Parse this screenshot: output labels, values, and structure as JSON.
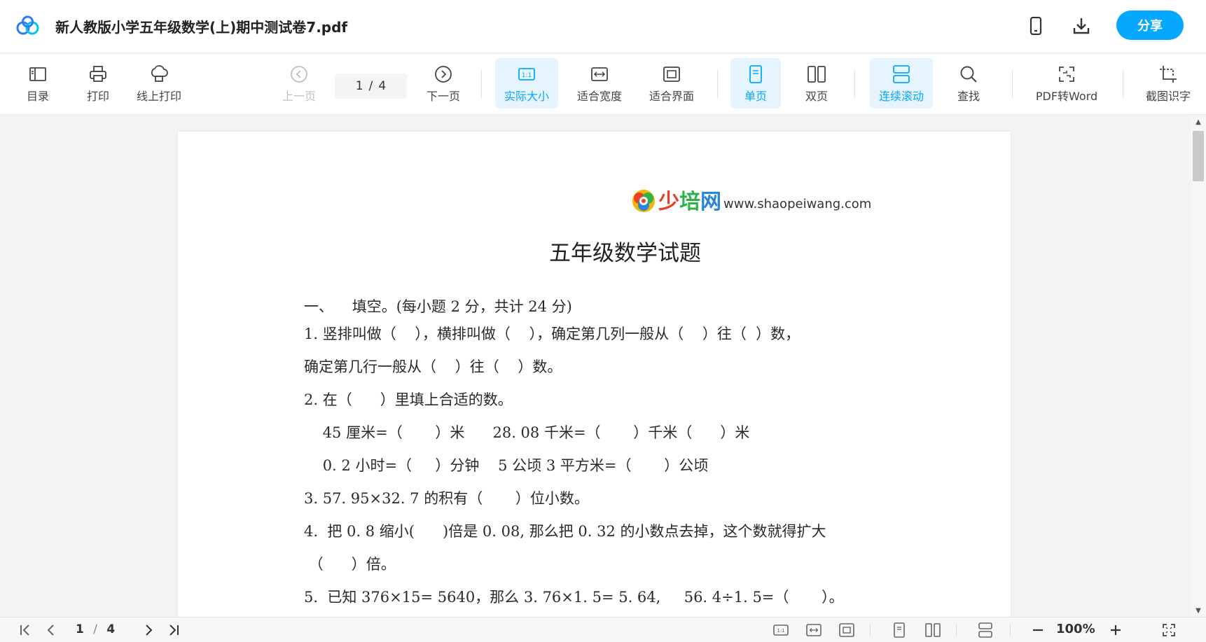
{
  "titlebar": {
    "doc_title": "新人教版小学五年级数学(上)期中测试卷7.pdf",
    "share_label": "分享",
    "icons": [
      "baidu-netdisk-logo",
      "mobile-icon",
      "download-icon"
    ]
  },
  "toolbar": {
    "toc_label": "目录",
    "print_label": "打印",
    "online_print_label": "线上打印",
    "prev_label": "上一页",
    "current_page": "1",
    "total_pages": "4",
    "page_separator": "/",
    "next_label": "下一页",
    "actual_size_label": "实际大小",
    "fit_width_label": "适合宽度",
    "fit_screen_label": "适合界面",
    "single_page_label": "单页",
    "double_page_label": "双页",
    "continuous_label": "连续滚动",
    "find_label": "查找",
    "pdf_to_word_label": "PDF转Word",
    "screenshot_ocr_label": "截图识字",
    "accent_color": "#06a7ff"
  },
  "document": {
    "logo_text_1": "少",
    "logo_text_2": "培",
    "logo_text_3": "网",
    "logo_url": "www.shaopeiwang.com",
    "heading": "五年级数学试题",
    "lines": [
      "一、    填空。(每小题 2 分，共计 24 分)",
      "1. 竖排叫做（    ），横排叫做（    ），确定第几列一般从（    ）往（  ）数，",
      "确定第几行一般从（    ）往（    ）数。",
      "2. 在（      ）里填上合适的数。",
      "    45 厘米=（       ）米      28. 08 千米=（       ）千米（      ）米",
      "    0. 2 小时=（     ）分钟    5 公顷 3 平方米=（       ）公顷",
      "3. 57. 95×32. 7 的积有（       ）位小数。",
      "4.  把 0. 8 缩小(      )倍是 0. 08, 那么把 0. 32 的小数点去掉，这个数就得扩大",
      " （      ）倍。",
      "5.  已知 376×15= 5640，那么 3. 76×1. 5= 5. 64,     56. 4÷1. 5=（       ）。"
    ]
  },
  "statusbar": {
    "current_page": "1",
    "page_separator": "/",
    "total_pages": "4",
    "zoom": "100%"
  }
}
